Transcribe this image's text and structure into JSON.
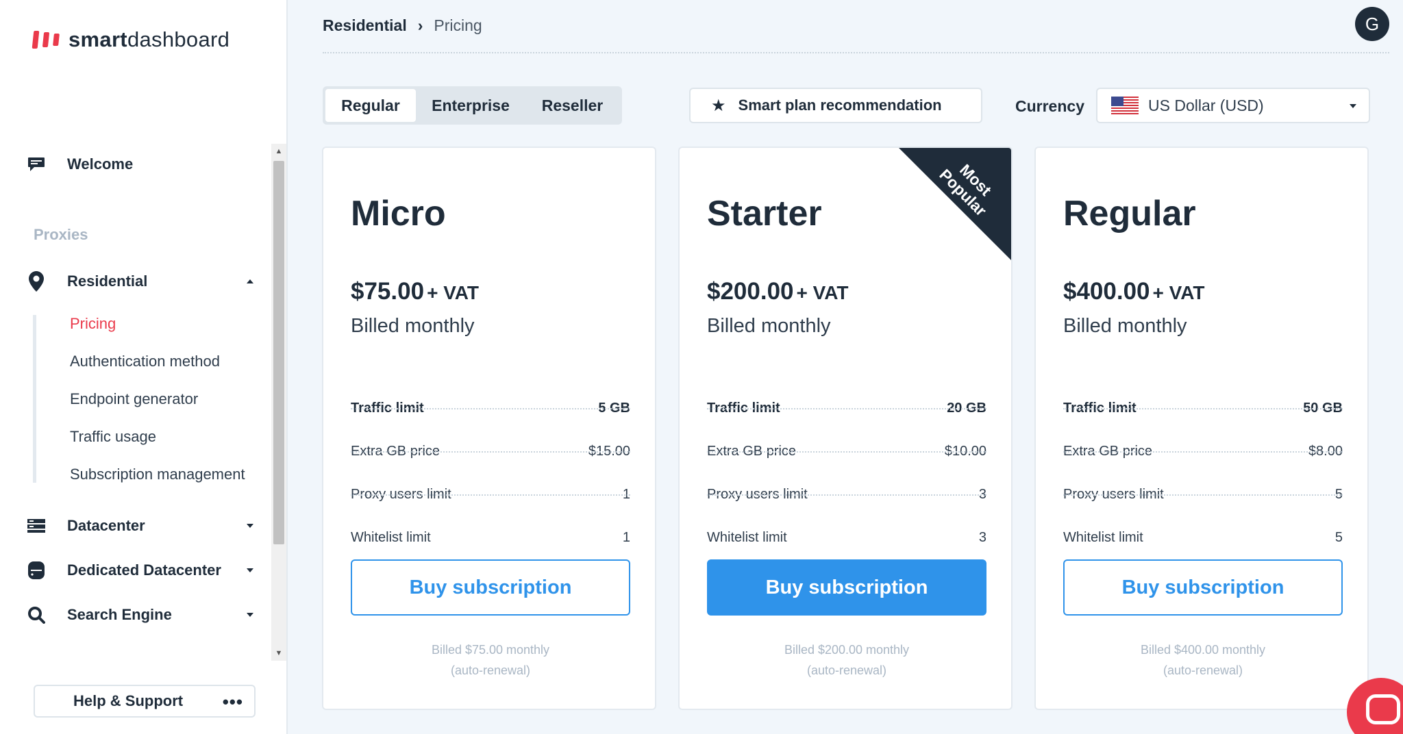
{
  "app": {
    "logo_bold": "smart",
    "logo_rest": "dashboard"
  },
  "sidebar": {
    "welcome": "Welcome",
    "section": "Proxies",
    "residential": "Residential",
    "sub_items": [
      "Pricing",
      "Authentication method",
      "Endpoint generator",
      "Traffic usage",
      "Subscription management"
    ],
    "datacenter": "Datacenter",
    "dedicated_datacenter": "Dedicated Datacenter",
    "search_engine": "Search Engine",
    "help": "Help & Support",
    "help_more": "•••"
  },
  "header": {
    "breadcrumb": [
      "Residential",
      "Pricing"
    ],
    "breadcrumb_sep": "›",
    "avatar": "G"
  },
  "controls": {
    "tabs": [
      "Regular",
      "Enterprise",
      "Reseller"
    ],
    "smart_plan": "Smart plan recommendation",
    "currency_label": "Currency",
    "currency_value": "US Dollar (USD)"
  },
  "plans": [
    {
      "name": "Micro",
      "price": "$75.00",
      "vat": "+ VAT",
      "billing": "Billed monthly",
      "features": [
        [
          "Traffic limit",
          "5 GB"
        ],
        [
          "Extra GB price",
          "$15.00"
        ],
        [
          "Proxy users limit",
          "1"
        ],
        [
          "Whitelist limit",
          "1"
        ]
      ],
      "button": "Buy subscription",
      "note_line1": "Billed $75.00 monthly",
      "note_line2": "(auto-renewal)"
    },
    {
      "name": "Starter",
      "price": "$200.00",
      "vat": "+ VAT",
      "billing": "Billed monthly",
      "badge": "Most Popular",
      "features": [
        [
          "Traffic limit",
          "20 GB"
        ],
        [
          "Extra GB price",
          "$10.00"
        ],
        [
          "Proxy users limit",
          "3"
        ],
        [
          "Whitelist limit",
          "3"
        ]
      ],
      "button": "Buy subscription",
      "note_line1": "Billed $200.00 monthly",
      "note_line2": "(auto-renewal)"
    },
    {
      "name": "Regular",
      "price": "$400.00",
      "vat": "+ VAT",
      "billing": "Billed monthly",
      "features": [
        [
          "Traffic limit",
          "50 GB"
        ],
        [
          "Extra GB price",
          "$8.00"
        ],
        [
          "Proxy users limit",
          "5"
        ],
        [
          "Whitelist limit",
          "5"
        ]
      ],
      "button": "Buy subscription",
      "note_line1": "Billed $400.00 monthly",
      "note_line2": "(auto-renewal)"
    }
  ],
  "colors": {
    "accent": "#2f93ea",
    "brand": "#ea3a4b",
    "dark": "#1f2c3a"
  }
}
